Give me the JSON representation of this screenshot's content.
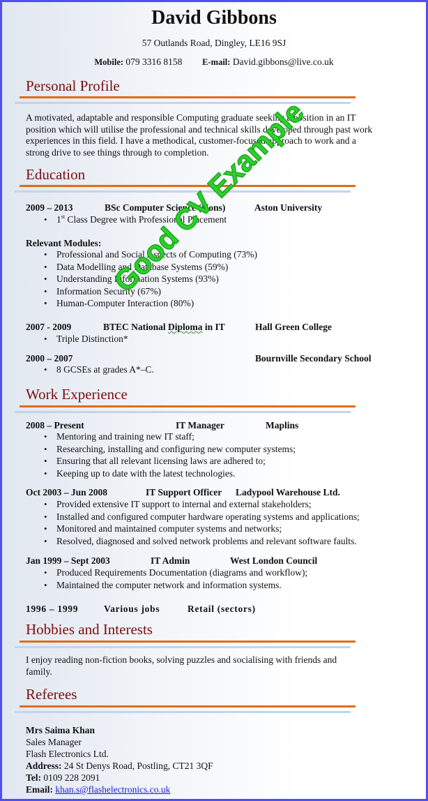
{
  "header": {
    "name": "David Gibbons",
    "address": "57 Outlands Road, Dingley, LE16 9SJ",
    "mobile_label": "Mobile:",
    "mobile": "079 3316 8158",
    "email_label": "E-mail:",
    "email": "David.gibbons@live.co.uk"
  },
  "watermark": "Good CV Example",
  "profile": {
    "title": "Personal Profile",
    "text": "A motivated, adaptable and responsible Computing graduate seeking a position in an IT position which will utilise the professional and technical skills developed through past work experiences in this field. I have a methodical, customer-focused approach to work and a strong drive to see things through to completion."
  },
  "education": {
    "title": "Education",
    "entries": [
      {
        "dates": "2009 – 2013",
        "qualification": "BSc Computer Science (Hons)",
        "institution": "Aston University",
        "bullet_ordinal": "1",
        "bullet_sup": "st",
        "bullet_rest": " Class Degree with Professional Placement"
      },
      {
        "dates": "2007 - 2009",
        "qualification_a": "BTEC National ",
        "qualification_b": "Diploma",
        "qualification_c": " in IT",
        "institution": "Hall Green College",
        "bullets": [
          "Triple Distinction*"
        ]
      },
      {
        "dates": "2000 – 2007",
        "institution": "Bournville Secondary School",
        "bullets": [
          "8 GCSEs at grades A*–C."
        ]
      }
    ],
    "modules_label": "Relevant Modules:",
    "modules": [
      "Professional and Social Aspects of Computing (73%)",
      "Data Modelling and Database Systems (59%)",
      "Understanding Information Systems (93%)",
      "Information Security (67%)",
      "Human-Computer Interaction (80%)"
    ]
  },
  "work": {
    "title": "Work Experience",
    "jobs": [
      {
        "dates": "2008 – Present",
        "role": "IT Manager",
        "company": "Maplins",
        "bullets": [
          "Mentoring and training new IT staff;",
          "Researching, installing and configuring new computer systems;",
          "Ensuring that all relevant licensing laws are adhered to;",
          "Keeping up to date with the latest technologies."
        ]
      },
      {
        "dates": "Oct 2003 – Jun 2008",
        "role": "IT Support Officer",
        "company": "Ladypool Warehouse Ltd.",
        "bullets": [
          "Provided extensive IT support to internal and external stakeholders;",
          "Installed and configured computer hardware operating systems and applications;",
          "Monitored and maintained computer systems and networks;",
          "Resolved, diagnosed and solved network problems and relevant software faults."
        ]
      },
      {
        "dates": "Jan 1999 – Sept 2003",
        "role": "IT Admin",
        "company": "West London Council",
        "bullets": [
          "Produced Requirements Documentation (diagrams and workflow);",
          "Maintained the computer network and information systems."
        ]
      },
      {
        "dates": "1996 – 1999",
        "role": "Various jobs",
        "company": "Retail (sectors)"
      }
    ]
  },
  "hobbies": {
    "title": "Hobbies and Interests",
    "text": "I enjoy reading non-fiction books, solving puzzles and socialising with friends and family."
  },
  "referees": {
    "title": "Referees",
    "name": "Mrs Saima Khan",
    "position": "Sales Manager",
    "company": "Flash Electronics Ltd.",
    "address_label": "Address:",
    "address": "24 St Denys Road, Postling, CT21 3QF",
    "tel_label": "Tel:",
    "tel": "0109 228 2091",
    "email_label": "Email:",
    "email": "khan.s@flashelectronics.co.uk"
  },
  "colors": {
    "border": "#4f4ff5",
    "heading": "#7b0d0d",
    "rule_orange": "#e06c14",
    "rule_blue": "#c2d5ee",
    "watermark": "#2cd12c",
    "link": "#1a1ad8"
  }
}
